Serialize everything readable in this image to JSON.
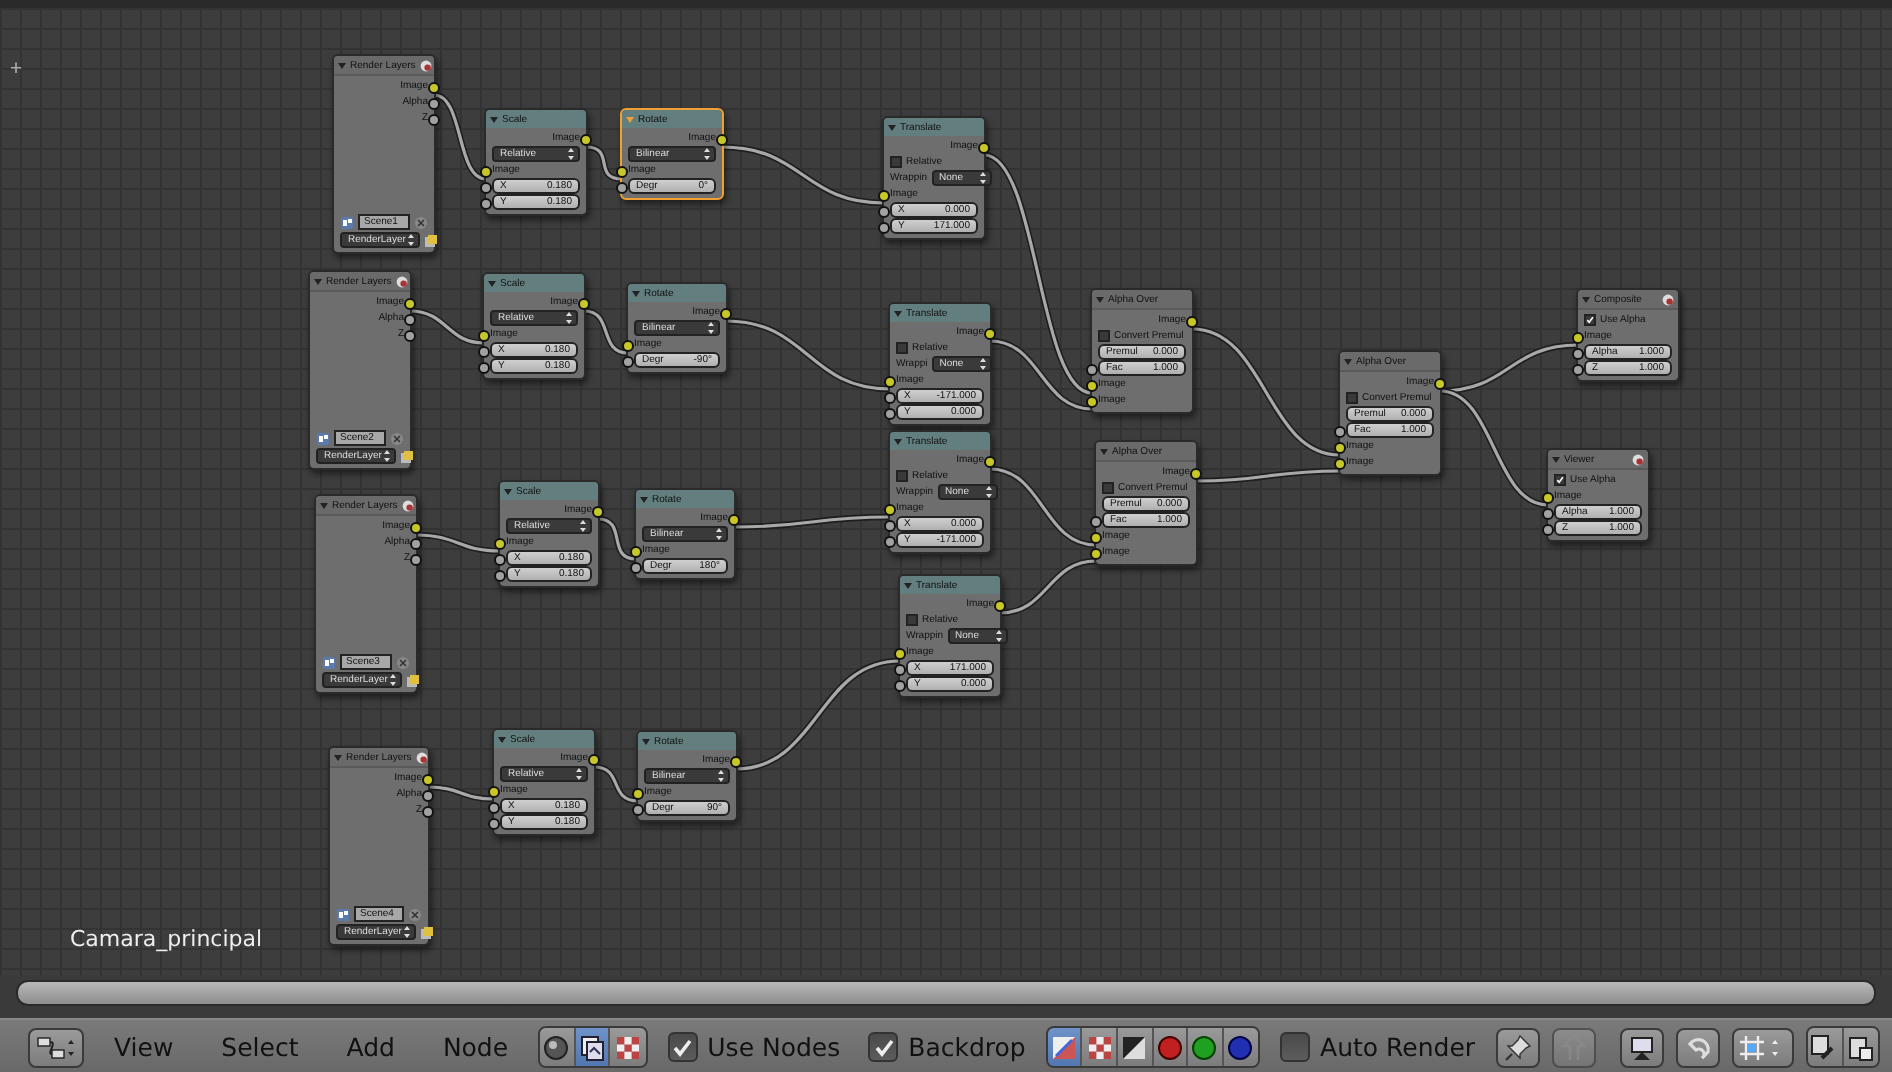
{
  "canvas": {
    "corner_symbol": "+",
    "label": "Camara_principal",
    "nodes": [
      {
        "kind": "render_layers",
        "title": "Render Layers",
        "selected": false,
        "rows": [
          {
            "kind": "output",
            "color": "#c7c729",
            "label": "Image"
          },
          {
            "kind": "output",
            "color": "#a1a1a1",
            "label": "Alpha"
          },
          {
            "kind": "output",
            "color": "#a1a1a1",
            "label": "Z"
          },
          {
            "kind": "scene",
            "value": "Scene1"
          },
          {
            "kind": "layer",
            "value": "RenderLayer"
          }
        ]
      },
      {
        "kind": "scale",
        "title": "Scale",
        "selected": false,
        "rows": [
          {
            "kind": "output",
            "color": "#c7c729",
            "label": "Image"
          },
          {
            "kind": "select",
            "value": "Relative"
          },
          {
            "kind": "input",
            "color": "#c7c729",
            "label": "Image"
          },
          {
            "kind": "value",
            "label": "X",
            "value": "0.180"
          },
          {
            "kind": "value",
            "label": "Y",
            "value": "0.180"
          }
        ]
      },
      {
        "kind": "rotate",
        "title": "Rotate",
        "selected": true,
        "rows": [
          {
            "kind": "output",
            "color": "#c7c729",
            "label": "Image"
          },
          {
            "kind": "select",
            "value": "Bilinear"
          },
          {
            "kind": "input",
            "color": "#c7c729",
            "label": "Image"
          },
          {
            "kind": "value",
            "label": "Degr",
            "value": "0°"
          }
        ]
      },
      {
        "kind": "translate",
        "title": "Translate",
        "selected": false,
        "rows": [
          {
            "kind": "output",
            "color": "#c7c729",
            "label": "Image"
          },
          {
            "kind": "check",
            "label": "Relative",
            "checked": false
          },
          {
            "kind": "labeled_select",
            "label": "Wrappin",
            "value": "None"
          },
          {
            "kind": "input",
            "color": "#c7c729",
            "label": "Image"
          },
          {
            "kind": "value",
            "label": "X",
            "value": "0.000"
          },
          {
            "kind": "value",
            "label": "Y",
            "value": "171.000"
          }
        ]
      },
      {
        "kind": "render_layers",
        "title": "Render Layers",
        "selected": false,
        "rows": [
          {
            "kind": "output",
            "color": "#c7c729",
            "label": "Image"
          },
          {
            "kind": "output",
            "color": "#a1a1a1",
            "label": "Alpha"
          },
          {
            "kind": "output",
            "color": "#a1a1a1",
            "label": "Z"
          },
          {
            "kind": "scene",
            "value": "Scene2"
          },
          {
            "kind": "layer",
            "value": "RenderLayer"
          }
        ]
      },
      {
        "kind": "scale",
        "title": "Scale",
        "selected": false,
        "rows": [
          {
            "kind": "output",
            "color": "#c7c729",
            "label": "Image"
          },
          {
            "kind": "select",
            "value": "Relative"
          },
          {
            "kind": "input",
            "color": "#c7c729",
            "label": "Image"
          },
          {
            "kind": "value",
            "label": "X",
            "value": "0.180"
          },
          {
            "kind": "value",
            "label": "Y",
            "value": "0.180"
          }
        ]
      },
      {
        "kind": "rotate",
        "title": "Rotate",
        "selected": false,
        "rows": [
          {
            "kind": "output",
            "color": "#c7c729",
            "label": "Image"
          },
          {
            "kind": "select",
            "value": "Bilinear"
          },
          {
            "kind": "input",
            "color": "#c7c729",
            "label": "Image"
          },
          {
            "kind": "value",
            "label": "Degr",
            "value": "-90°"
          }
        ]
      },
      {
        "kind": "translate",
        "title": "Translate",
        "selected": false,
        "rows": [
          {
            "kind": "output",
            "color": "#c7c729",
            "label": "Image"
          },
          {
            "kind": "check",
            "label": "Relative",
            "checked": false
          },
          {
            "kind": "labeled_select",
            "label": "Wrappi",
            "value": "None"
          },
          {
            "kind": "input",
            "color": "#c7c729",
            "label": "Image"
          },
          {
            "kind": "value",
            "label": "X",
            "value": "-171.000"
          },
          {
            "kind": "value",
            "label": "Y",
            "value": "0.000"
          }
        ]
      },
      {
        "kind": "render_layers",
        "title": "Render Layers",
        "selected": false,
        "rows": [
          {
            "kind": "output",
            "color": "#c7c729",
            "label": "Image"
          },
          {
            "kind": "output",
            "color": "#a1a1a1",
            "label": "Alpha"
          },
          {
            "kind": "output",
            "color": "#a1a1a1",
            "label": "Z"
          },
          {
            "kind": "scene",
            "value": "Scene3"
          },
          {
            "kind": "layer",
            "value": "RenderLayer"
          }
        ]
      },
      {
        "kind": "scale",
        "title": "Scale",
        "selected": false,
        "rows": [
          {
            "kind": "output",
            "color": "#c7c729",
            "label": "Image"
          },
          {
            "kind": "select",
            "value": "Relative"
          },
          {
            "kind": "input",
            "color": "#c7c729",
            "label": "Image"
          },
          {
            "kind": "value",
            "label": "X",
            "value": "0.180"
          },
          {
            "kind": "value",
            "label": "Y",
            "value": "0.180"
          }
        ]
      },
      {
        "kind": "rotate",
        "title": "Rotate",
        "selected": false,
        "rows": [
          {
            "kind": "output",
            "color": "#c7c729",
            "label": "Image"
          },
          {
            "kind": "select",
            "value": "Bilinear"
          },
          {
            "kind": "input",
            "color": "#c7c729",
            "label": "Image"
          },
          {
            "kind": "value",
            "label": "Degr",
            "value": "180°"
          }
        ]
      },
      {
        "kind": "translate",
        "title": "Translate",
        "selected": false,
        "rows": [
          {
            "kind": "output",
            "color": "#c7c729",
            "label": "Image"
          },
          {
            "kind": "check",
            "label": "Relative",
            "checked": false
          },
          {
            "kind": "labeled_select",
            "label": "Wrappin",
            "value": "None"
          },
          {
            "kind": "input",
            "color": "#c7c729",
            "label": "Image"
          },
          {
            "kind": "value",
            "label": "X",
            "value": "0.000"
          },
          {
            "kind": "value",
            "label": "Y",
            "value": "-171.000"
          }
        ]
      },
      {
        "kind": "render_layers",
        "title": "Render Layers",
        "selected": false,
        "rows": [
          {
            "kind": "output",
            "color": "#c7c729",
            "label": "Image"
          },
          {
            "kind": "output",
            "color": "#a1a1a1",
            "label": "Alpha"
          },
          {
            "kind": "output",
            "color": "#a1a1a1",
            "label": "Z"
          },
          {
            "kind": "scene",
            "value": "Scene4"
          },
          {
            "kind": "layer",
            "value": "RenderLayer"
          }
        ]
      },
      {
        "kind": "scale",
        "title": "Scale",
        "selected": false,
        "rows": [
          {
            "kind": "output",
            "color": "#c7c729",
            "label": "Image"
          },
          {
            "kind": "select",
            "value": "Relative"
          },
          {
            "kind": "input",
            "color": "#c7c729",
            "label": "Image"
          },
          {
            "kind": "value",
            "label": "X",
            "value": "0.180"
          },
          {
            "kind": "value",
            "label": "Y",
            "value": "0.180"
          }
        ]
      },
      {
        "kind": "rotate",
        "title": "Rotate",
        "selected": false,
        "rows": [
          {
            "kind": "output",
            "color": "#c7c729",
            "label": "Image"
          },
          {
            "kind": "select",
            "value": "Bilinear"
          },
          {
            "kind": "input",
            "color": "#c7c729",
            "label": "Image"
          },
          {
            "kind": "value",
            "label": "Degr",
            "value": "90°"
          }
        ]
      },
      {
        "kind": "translate",
        "title": "Translate",
        "selected": false,
        "rows": [
          {
            "kind": "output",
            "color": "#c7c729",
            "label": "Image"
          },
          {
            "kind": "check",
            "label": "Relative",
            "checked": false
          },
          {
            "kind": "labeled_select",
            "label": "Wrappin",
            "value": "None"
          },
          {
            "kind": "input",
            "color": "#c7c729",
            "label": "Image"
          },
          {
            "kind": "value",
            "label": "X",
            "value": "171.000"
          },
          {
            "kind": "value",
            "label": "Y",
            "value": "0.000"
          }
        ]
      },
      {
        "kind": "alpha_over",
        "title": "Alpha Over",
        "selected": false,
        "rows": [
          {
            "kind": "output",
            "color": "#c7c729",
            "label": "Image"
          },
          {
            "kind": "check",
            "label": "Convert Premul",
            "checked": false
          },
          {
            "kind": "setting",
            "label": "Premul",
            "value": "0.000"
          },
          {
            "kind": "value",
            "label": "Fac",
            "value": "1.000"
          },
          {
            "kind": "input",
            "color": "#c7c729",
            "label": "Image"
          },
          {
            "kind": "input",
            "color": "#c7c729",
            "label": "Image"
          }
        ]
      },
      {
        "kind": "alpha_over",
        "title": "Alpha Over",
        "selected": false,
        "rows": [
          {
            "kind": "output",
            "color": "#c7c729",
            "label": "Image"
          },
          {
            "kind": "check",
            "label": "Convert Premul",
            "checked": false
          },
          {
            "kind": "setting",
            "label": "Premul",
            "value": "0.000"
          },
          {
            "kind": "value",
            "label": "Fac",
            "value": "1.000"
          },
          {
            "kind": "input",
            "color": "#c7c729",
            "label": "Image"
          },
          {
            "kind": "input",
            "color": "#c7c729",
            "label": "Image"
          }
        ]
      },
      {
        "kind": "alpha_over",
        "title": "Alpha Over",
        "selected": false,
        "rows": [
          {
            "kind": "output",
            "color": "#c7c729",
            "label": "Image"
          },
          {
            "kind": "check",
            "label": "Convert Premul",
            "checked": false
          },
          {
            "kind": "setting",
            "label": "Premul",
            "value": "0.000"
          },
          {
            "kind": "value",
            "label": "Fac",
            "value": "1.000"
          },
          {
            "kind": "input",
            "color": "#c7c729",
            "label": "Image"
          },
          {
            "kind": "input",
            "color": "#c7c729",
            "label": "Image"
          }
        ]
      },
      {
        "kind": "composite",
        "title": "Composite",
        "selected": false,
        "rows": [
          {
            "kind": "check",
            "label": "Use Alpha",
            "checked": true
          },
          {
            "kind": "input",
            "color": "#c7c729",
            "label": "Image"
          },
          {
            "kind": "value",
            "label": "Alpha",
            "value": "1.000"
          },
          {
            "kind": "value",
            "label": "Z",
            "value": "1.000"
          }
        ]
      },
      {
        "kind": "viewer",
        "title": "Viewer",
        "selected": false,
        "rows": [
          {
            "kind": "check",
            "label": "Use Alpha",
            "checked": true
          },
          {
            "kind": "input",
            "color": "#c7c729",
            "label": "Image"
          },
          {
            "kind": "value",
            "label": "Alpha",
            "value": "1.000"
          },
          {
            "kind": "value",
            "label": "Z",
            "value": "1.000"
          }
        ]
      }
    ]
  },
  "toolbar": {
    "menus": [
      "View",
      "Select",
      "Add",
      "Node"
    ],
    "tree_types": [
      {
        "kind": "shader",
        "selected": false
      },
      {
        "kind": "compositing",
        "selected": true
      },
      {
        "kind": "texture",
        "selected": false
      }
    ],
    "toggles": [
      {
        "label": "Use Nodes",
        "checked": true
      },
      {
        "label": "Backdrop",
        "checked": true
      }
    ],
    "channels": [
      {
        "kind": "color_alpha",
        "selected": true
      },
      {
        "kind": "checker",
        "selected": false
      },
      {
        "kind": "alpha",
        "selected": false
      },
      {
        "kind": "red",
        "selected": false
      },
      {
        "kind": "green",
        "selected": false
      },
      {
        "kind": "blue",
        "selected": false
      }
    ],
    "auto_render": {
      "label": "Auto Render",
      "checked": false
    }
  }
}
